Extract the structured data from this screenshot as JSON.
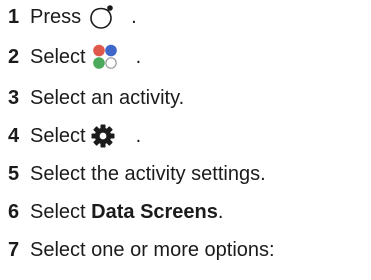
{
  "steps": [
    {
      "number": "1",
      "before": "Press ",
      "icon": "watch-button-icon",
      "after": "."
    },
    {
      "number": "2",
      "before": "Select ",
      "icon": "colored-dots-menu-icon",
      "after": "."
    },
    {
      "number": "3",
      "text": "Select an activity."
    },
    {
      "number": "4",
      "before": "Select ",
      "icon": "gear-icon",
      "after": "."
    },
    {
      "number": "5",
      "text": "Select the activity settings."
    },
    {
      "number": "6",
      "before": "Select ",
      "bold": "Data Screens",
      "after": "."
    },
    {
      "number": "7",
      "text": "Select one or more options:"
    }
  ],
  "colors": {
    "text": "#1b1b1b",
    "dot_red": "#e0594d",
    "dot_blue": "#3f67c9",
    "dot_green": "#4caa5c",
    "dot_outline": "#9a9a9a"
  }
}
